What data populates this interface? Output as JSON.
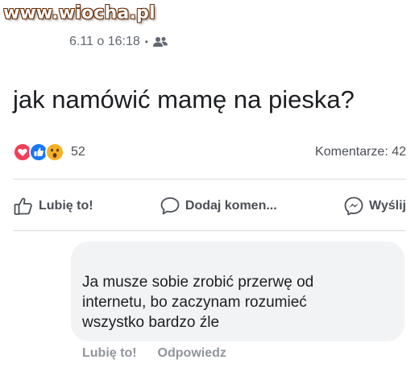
{
  "watermark": {
    "text": "www.wiocha.pl"
  },
  "post": {
    "timestamp": "6.11 o 16:18",
    "separator": "•",
    "audience_icon": "friends-icon",
    "text": "jak namówić mamę na pieska?"
  },
  "reactions": {
    "icons": [
      "love-reaction-icon",
      "like-reaction-icon",
      "wow-reaction-icon"
    ],
    "count": "52",
    "comments_label": "Komentarze: 42"
  },
  "actions": {
    "like_label": "Lubię to!",
    "comment_label": "Dodaj komen...",
    "send_label": "Wyślij"
  },
  "comment": {
    "line1": "Ja musze sobie zrobić przerwę od",
    "line2": "internetu, bo zaczynam rozumieć",
    "line3": "wszystko bardzo źle",
    "like_label": "Lubię to!",
    "reply_label": "Odpowiedz"
  },
  "colors": {
    "text": "#1c1e21",
    "secondary_text": "#606770",
    "action_text": "#4b4f56",
    "comment_bg": "#f2f3f5",
    "love": "#f33e58",
    "like": "#1877f2",
    "wow": "#f7b125"
  }
}
